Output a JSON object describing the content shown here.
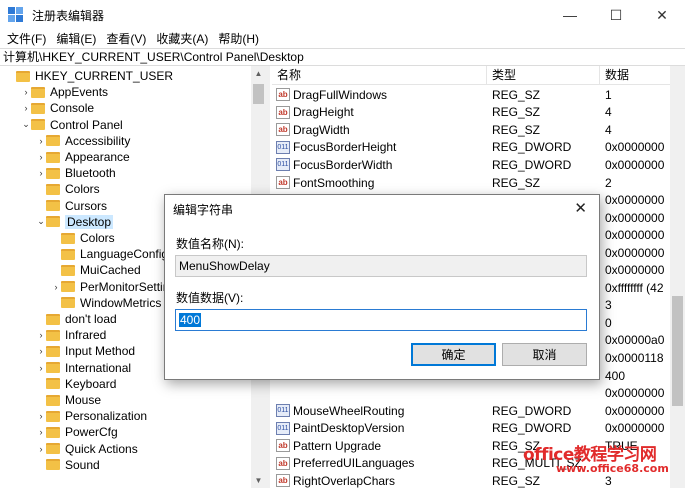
{
  "window": {
    "title": "注册表编辑器",
    "controls": {
      "minimize": "—",
      "maximize": "☐",
      "close": "✕"
    }
  },
  "menu": [
    "文件(F)",
    "编辑(E)",
    "查看(V)",
    "收藏夹(A)",
    "帮助(H)"
  ],
  "address": "计算机\\HKEY_CURRENT_USER\\Control Panel\\Desktop",
  "tree": {
    "items": [
      {
        "label": "HKEY_CURRENT_USER",
        "expander": ""
      },
      {
        "label": "AppEvents",
        "expander": ">"
      },
      {
        "label": "Console",
        "expander": ">"
      },
      {
        "label": "Control Panel",
        "expander": "v"
      },
      {
        "label": "Accessibility",
        "expander": ">"
      },
      {
        "label": "Appearance",
        "expander": ">"
      },
      {
        "label": "Bluetooth",
        "expander": ">"
      },
      {
        "label": "Colors",
        "expander": ""
      },
      {
        "label": "Cursors",
        "expander": ""
      },
      {
        "label": "Desktop",
        "expander": "v"
      },
      {
        "label": "Colors",
        "expander": ""
      },
      {
        "label": "LanguageConfigu",
        "expander": ""
      },
      {
        "label": "MuiCached",
        "expander": ""
      },
      {
        "label": "PerMonitorSetting",
        "expander": ">"
      },
      {
        "label": "WindowMetrics",
        "expander": ""
      },
      {
        "label": "don't load",
        "expander": ""
      },
      {
        "label": "Infrared",
        "expander": ">"
      },
      {
        "label": "Input Method",
        "expander": ">"
      },
      {
        "label": "International",
        "expander": ">"
      },
      {
        "label": "Keyboard",
        "expander": ""
      },
      {
        "label": "Mouse",
        "expander": ""
      },
      {
        "label": "Personalization",
        "expander": ">"
      },
      {
        "label": "PowerCfg",
        "expander": ">"
      },
      {
        "label": "Quick Actions",
        "expander": ">"
      },
      {
        "label": "Sound",
        "expander": ""
      }
    ]
  },
  "list": {
    "headers": {
      "name": "名称",
      "type": "类型",
      "data": "数据"
    },
    "rows": [
      {
        "icon": "ab",
        "name": "DragFullWindows",
        "type": "REG_SZ",
        "data": "1"
      },
      {
        "icon": "ab",
        "name": "DragHeight",
        "type": "REG_SZ",
        "data": "4"
      },
      {
        "icon": "ab",
        "name": "DragWidth",
        "type": "REG_SZ",
        "data": "4"
      },
      {
        "icon": "dw",
        "name": "FocusBorderHeight",
        "type": "REG_DWORD",
        "data": "0x0000000"
      },
      {
        "icon": "dw",
        "name": "FocusBorderWidth",
        "type": "REG_DWORD",
        "data": "0x0000000"
      },
      {
        "icon": "ab",
        "name": "FontSmoothing",
        "type": "REG_SZ",
        "data": "2"
      },
      {
        "icon": "",
        "name": "",
        "type": "",
        "data": "0x0000000"
      },
      {
        "icon": "",
        "name": "",
        "type": "",
        "data": "0x0000000"
      },
      {
        "icon": "",
        "name": "",
        "type": "",
        "data": "0x0000000"
      },
      {
        "icon": "",
        "name": "",
        "type": "",
        "data": "0x0000000"
      },
      {
        "icon": "",
        "name": "",
        "type": "",
        "data": "0x0000000"
      },
      {
        "icon": "",
        "name": "",
        "type": "",
        "data": "0xffffffff (42"
      },
      {
        "icon": "",
        "name": "",
        "type": "",
        "data": "3"
      },
      {
        "icon": "",
        "name": "",
        "type": "",
        "data": "0"
      },
      {
        "icon": "",
        "name": "",
        "type": "",
        "data": "0x00000a0"
      },
      {
        "icon": "",
        "name": "",
        "type": "",
        "data": "0x0000118"
      },
      {
        "icon": "",
        "name": "",
        "type": "",
        "data": "400"
      },
      {
        "icon": "",
        "name": "",
        "type": "",
        "data": "0x0000000"
      },
      {
        "icon": "dw",
        "name": "MouseWheelRouting",
        "type": "REG_DWORD",
        "data": "0x0000000"
      },
      {
        "icon": "dw",
        "name": "PaintDesktopVersion",
        "type": "REG_DWORD",
        "data": "0x0000000"
      },
      {
        "icon": "ab",
        "name": "Pattern Upgrade",
        "type": "REG_SZ",
        "data": "TRUE"
      },
      {
        "icon": "ab",
        "name": "PreferredUILanguages",
        "type": "REG_MULTI_SZ",
        "data": ""
      },
      {
        "icon": "ab",
        "name": "RightOverlapChars",
        "type": "REG_SZ",
        "data": "3"
      }
    ]
  },
  "dialog": {
    "title": "编辑字符串",
    "close": "✕",
    "name_label": "数值名称(N):",
    "name_value": "MenuShowDelay",
    "data_label": "数值数据(V):",
    "data_value": "400",
    "ok": "确定",
    "cancel": "取消"
  },
  "watermark": {
    "text": "office教程学习网",
    "url": "www.office68.com"
  },
  "colors": {
    "selection": "#0078d7",
    "folder": "#f3c146",
    "watermark": "#e12b2b"
  }
}
